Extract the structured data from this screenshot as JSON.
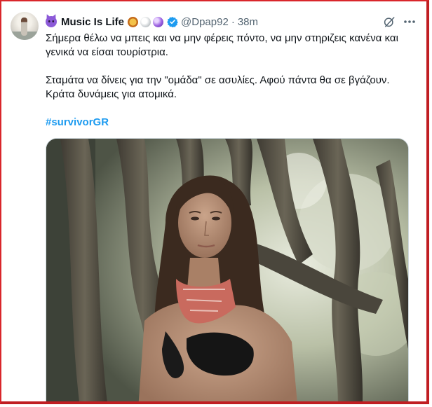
{
  "author": {
    "display_name": "Music Is Life",
    "handle": "@Dpap92",
    "separator": "·",
    "timestamp": "38m",
    "name_emojis": [
      "smiling-devil-emoji",
      "lion-emoji",
      "volleyball-emoji",
      "crystal-ball-emoji"
    ],
    "verified": true
  },
  "tweet": {
    "line1": "Σήμερα θέλω να μπεις και να μην φέρεις πόντο, να μην στηριζεις κανένα και",
    "line2": "γενικά να είσαι τουρίστρια.",
    "line3": "Σταμάτα να δίνεις για την \"ομάδα\" σε ασυλίες. Αφού πάντα θα σε βγάζουν.",
    "line4": "Κράτα δυνάμεις για ατομικά.",
    "hashtag": "#survivorGR"
  },
  "media": {
    "description_icon": "photo-image"
  },
  "colors": {
    "accent": "#1d9bf0",
    "text": "#0f1419",
    "muted": "#536471",
    "frame": "#d9262b"
  }
}
